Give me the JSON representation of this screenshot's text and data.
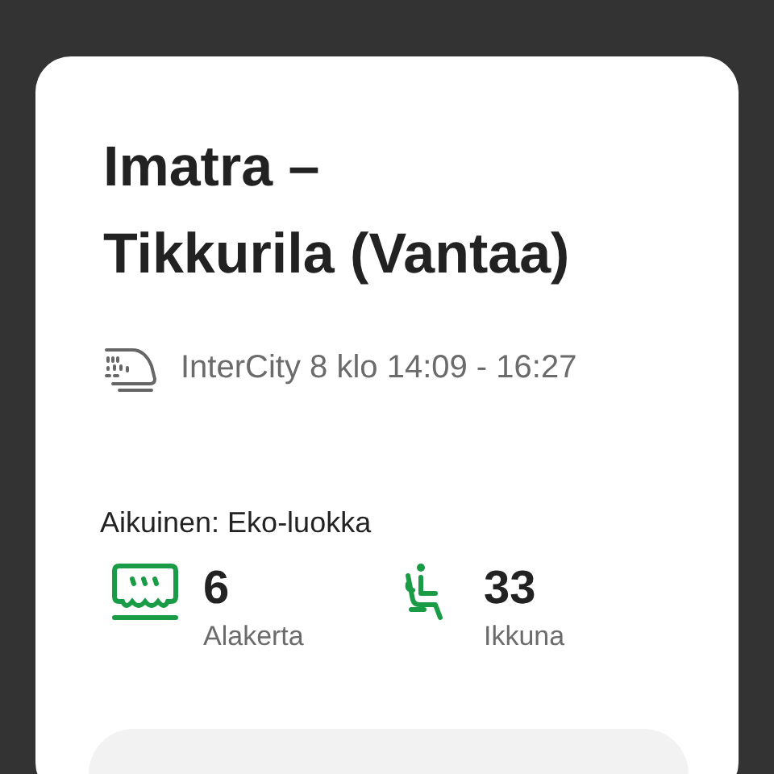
{
  "title": "Imatra –\nTikkurila (Vantaa)",
  "train": {
    "text": "InterCity 8 klo 14:09 - 16:27"
  },
  "ticket": {
    "passenger": "Aikuinen: Eko-luokka",
    "seat_info": [
      {
        "kind": "car",
        "number": "6",
        "label": "Alakerta"
      },
      {
        "kind": "seat",
        "number": "33",
        "label": "Ikkuna"
      }
    ]
  }
}
